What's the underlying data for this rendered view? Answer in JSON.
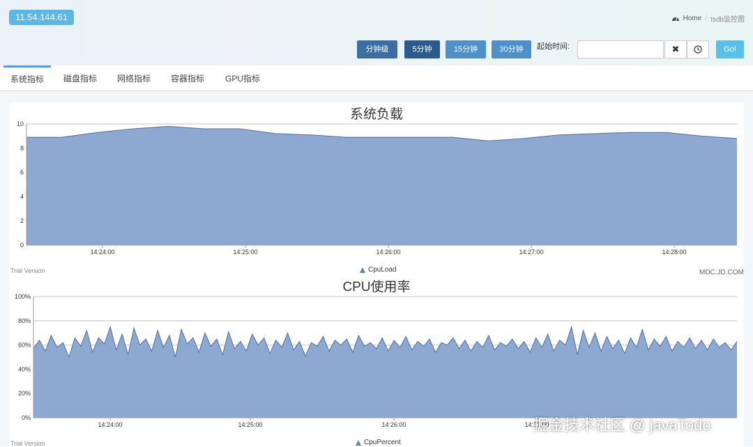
{
  "header": {
    "ip": "11.54.144.61",
    "breadcrumb": {
      "home": "Home",
      "current": "tsdb监控图"
    }
  },
  "controls": {
    "buttons": [
      "分钟级",
      "5分钟",
      "15分钟",
      "30分钟"
    ],
    "start_label": "起始时间:",
    "start_value": "",
    "clear_icon": "✖",
    "go_label": "Go!"
  },
  "tabs": [
    "系统指标",
    "磁盘指标",
    "网络指标",
    "容器指标",
    "GPU指标"
  ],
  "footer": {
    "trial": "Trial Version",
    "mdc": "MDC.JD.COM"
  },
  "watermark": "掘金技术社区 @ javaTodo",
  "colors": {
    "area_fill": "#8ea9d1",
    "area_line": "#4a6fa5",
    "accent": "#5bb7e6"
  },
  "chart_data": [
    {
      "type": "area",
      "title": "系统负载",
      "series": [
        {
          "name": "CpuLoad",
          "x": [
            "14:23:33",
            "14:23:50",
            "14:24:05",
            "14:24:20",
            "14:24:35",
            "14:24:50",
            "14:25:05",
            "14:25:20",
            "14:25:35",
            "14:25:50",
            "14:26:05",
            "14:26:20",
            "14:26:35",
            "14:26:50",
            "14:27:05",
            "14:27:20",
            "14:27:35",
            "14:27:50",
            "14:28:05",
            "14:28:20",
            "14:28:30"
          ],
          "values": [
            8.9,
            8.9,
            9.3,
            9.6,
            9.8,
            9.6,
            9.6,
            9.2,
            9.1,
            8.9,
            8.9,
            8.9,
            8.9,
            8.6,
            8.8,
            9.1,
            9.2,
            9.3,
            9.3,
            9.0,
            8.8
          ]
        }
      ],
      "x_ticks": [
        "14:24:00",
        "14:25:00",
        "14:26:00",
        "14:27:00",
        "14:28:00"
      ],
      "y_ticks": [
        "0",
        "2",
        "4",
        "6",
        "8",
        "10"
      ],
      "ylim": [
        0,
        10
      ]
    },
    {
      "type": "area",
      "title": "CPU使用率",
      "series": [
        {
          "name": "CpuPercent",
          "values": [
            57,
            64,
            55,
            68,
            58,
            62,
            50,
            66,
            59,
            72,
            54,
            66,
            61,
            75,
            56,
            69,
            52,
            74,
            60,
            65,
            55,
            72,
            58,
            68,
            50,
            73,
            61,
            66,
            54,
            70,
            59,
            65,
            52,
            71,
            57,
            63,
            55,
            69,
            60,
            66,
            53,
            64,
            58,
            70,
            56,
            63,
            51,
            62,
            59,
            67,
            55,
            64,
            60,
            65,
            54,
            68,
            59,
            62,
            57,
            66,
            55,
            64,
            58,
            67,
            56,
            63,
            59,
            65,
            54,
            62,
            60,
            66,
            57,
            64,
            55,
            63,
            58,
            68,
            56,
            62,
            59,
            65,
            57,
            63,
            54,
            66,
            58,
            69,
            55,
            64,
            60,
            75,
            52,
            72,
            58,
            70,
            55,
            67,
            57,
            64,
            53,
            66,
            58,
            73,
            56,
            65,
            59,
            67,
            55,
            63,
            58,
            66,
            57,
            64,
            56,
            65,
            58,
            62,
            56,
            63
          ]
        }
      ],
      "x_ticks": [
        "14:24:00",
        "14:25:00",
        "14:26:00",
        "14:27:00"
      ],
      "y_ticks": [
        "0%",
        "20%",
        "40%",
        "60%",
        "80%",
        "100%"
      ],
      "ylim": [
        0,
        100
      ]
    }
  ]
}
